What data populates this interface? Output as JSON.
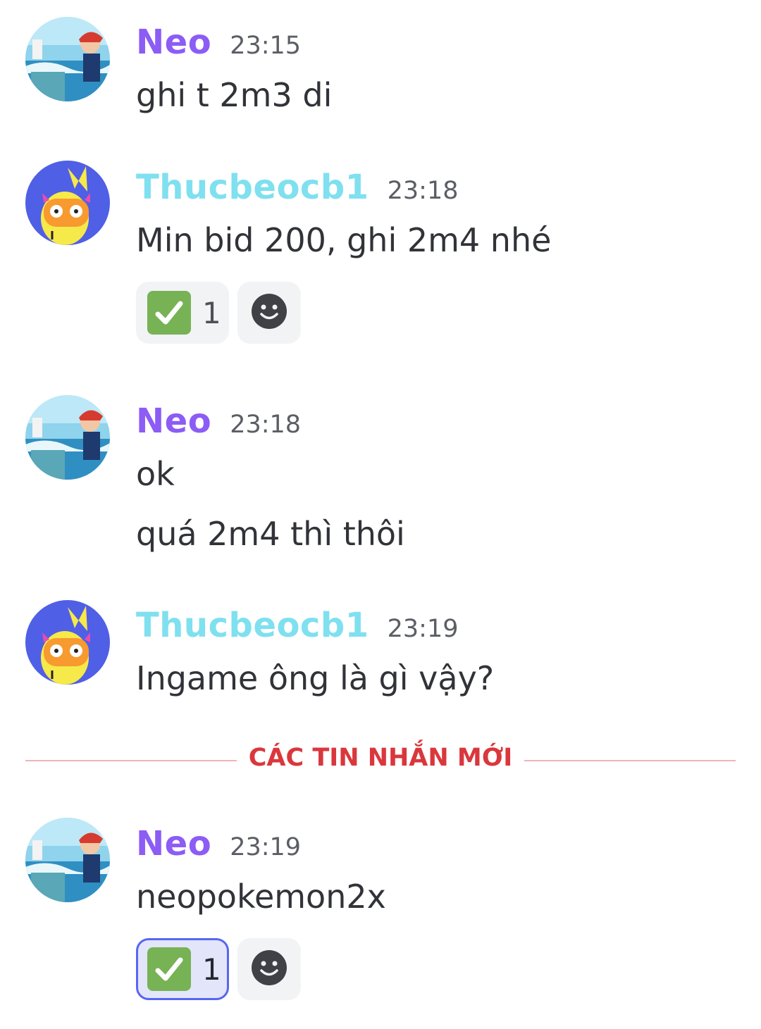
{
  "colors": {
    "neo": "#8c5cf5",
    "thuc": "#7fe0ef",
    "new_divider": "#da373c",
    "reaction_me_border": "#5865f2"
  },
  "messages": [
    {
      "author": "Neo",
      "time": "23:15",
      "lines": [
        "ghi t 2m3 di"
      ]
    },
    {
      "author": "Thucbeocb1",
      "time": "23:18",
      "lines": [
        "Min bid 200, ghi 2m4 nhé"
      ],
      "reaction": {
        "emoji": "white-check-mark",
        "count": "1"
      }
    },
    {
      "author": "Neo",
      "time": "23:18",
      "lines": [
        "ok",
        "quá 2m4 thì thôi"
      ]
    },
    {
      "author": "Thucbeocb1",
      "time": "23:19",
      "lines": [
        "Ingame ông là gì vậy?"
      ]
    },
    {
      "author": "Neo",
      "time": "23:19",
      "lines": [
        "neopokemon2x"
      ],
      "reaction": {
        "emoji": "white-check-mark",
        "count": "1",
        "reacted_by_me": true
      }
    }
  ],
  "new_messages_divider": "CÁC TIN NHẮN MỚI",
  "icons": {
    "add_reaction": "smiley-face-icon",
    "check": "check-mark-icon"
  }
}
